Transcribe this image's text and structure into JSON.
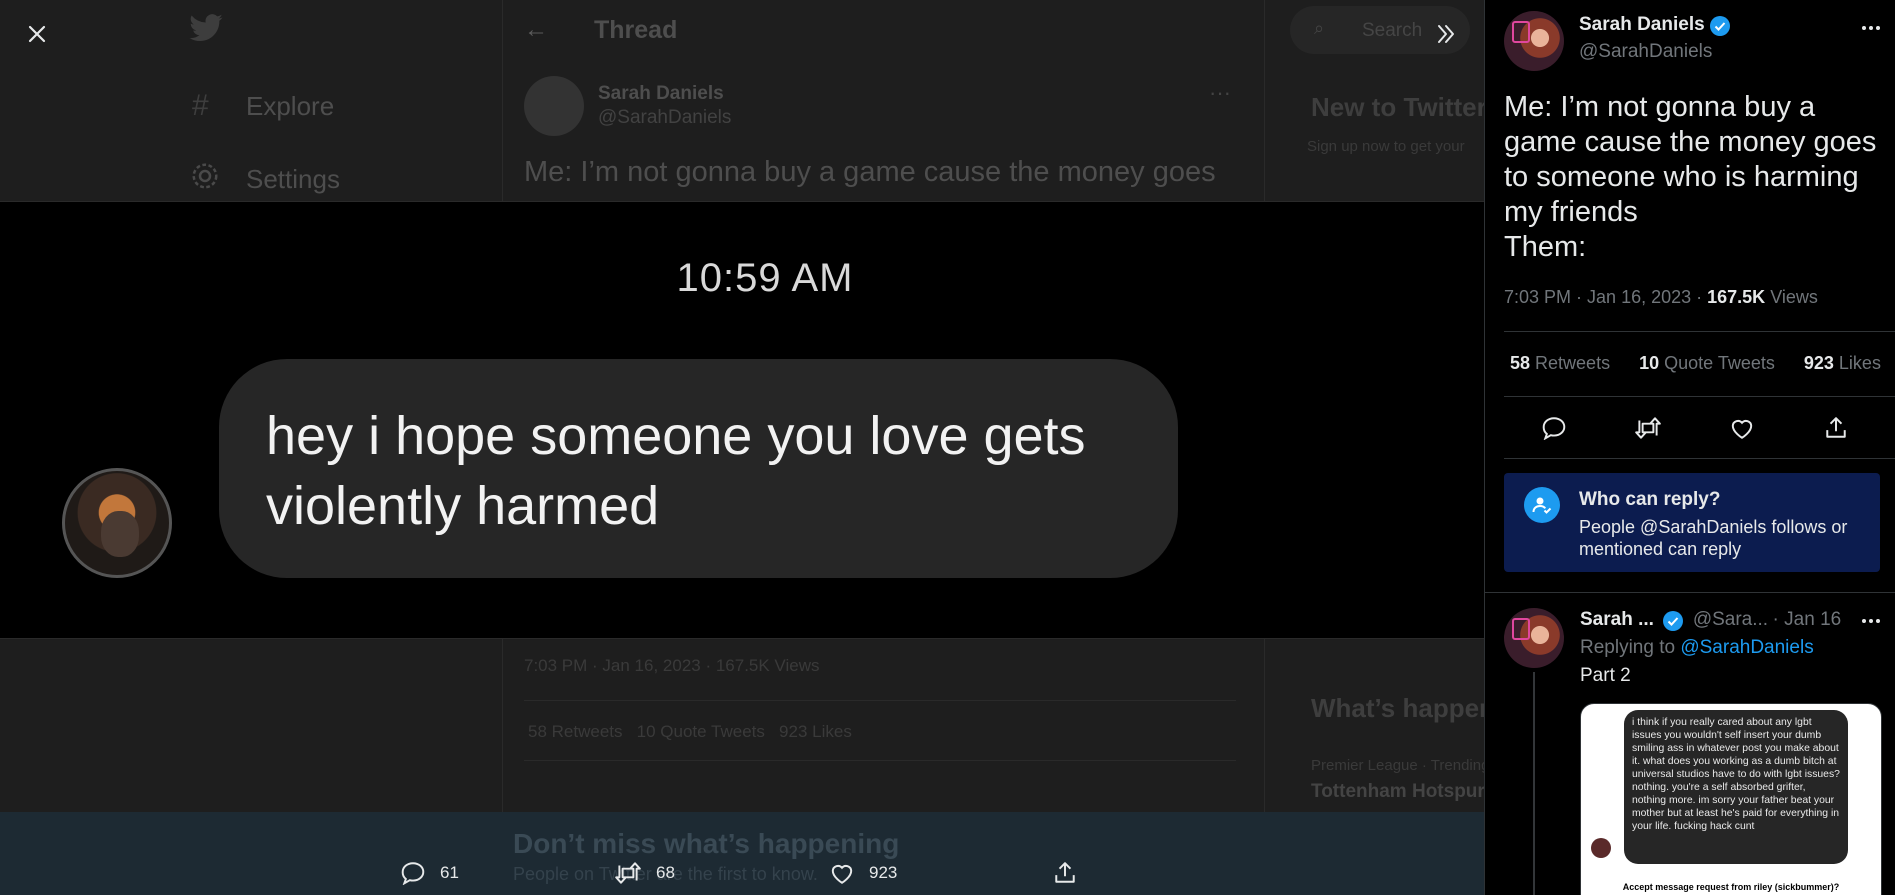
{
  "background": {
    "nav": {
      "explore_label": "Explore",
      "settings_label": "Settings"
    },
    "header": {
      "title": "Thread",
      "search_placeholder": "Search"
    },
    "sidebar": {
      "new_title": "New to Twitter?",
      "new_desc": "Sign up now to get your",
      "happening_title": "What’s happening",
      "trend_meta": "Premier League · Trending",
      "trend_name": "Tottenham Hotspur"
    },
    "tweet": {
      "name": "Sarah Daniels",
      "handle": "@SarahDaniels",
      "text": "Me: I’m not gonna buy a game cause the money goes",
      "meta": "7:03 PM · Jan 16, 2023 · 167.5K Views",
      "stats": "58 Retweets   10 Quote Tweets   923 Likes"
    },
    "banner": {
      "title": "Don’t miss what’s happening",
      "desc": "People on Twitter are the first to know."
    }
  },
  "media": {
    "time": "10:59 AM",
    "message": "hey i hope someone you love gets violently harmed",
    "actions": {
      "replies": "61",
      "retweets": "68",
      "likes": "923"
    }
  },
  "tweet": {
    "author_name": "Sarah Daniels",
    "author_handle": "@SarahDaniels",
    "text_lines": [
      "Me: I’m not gonna buy a",
      "game cause the money goes",
      "to someone who is harming",
      "my friends",
      "Them:"
    ],
    "time": "7:03 PM",
    "date": "Jan 16, 2023",
    "views_count": "167.5K",
    "views_label": "Views",
    "retweets_count": "58",
    "retweets_label": "Retweets",
    "quotes_count": "10",
    "quotes_label": "Quote Tweets",
    "likes_count": "923",
    "likes_label": "Likes"
  },
  "who_can_reply": {
    "title": "Who can reply?",
    "desc": "People @SarahDaniels follows or mentioned can reply"
  },
  "reply": {
    "author_name": "Sarah ...",
    "author_handle": "@Sara...",
    "date": "· Jan 16",
    "replying_prefix": "Replying to",
    "replying_to": "@SarahDaniels",
    "text": "Part 2",
    "image_dm": "i think if you really cared about any lgbt issues you wouldn't self insert your dumb smiling ass in whatever post you make about it. what does you working as a dumb bitch at universal studios have to do with lgbt issues? nothing. you're a self absorbed grifter, nothing more. im sorry your father beat your mother but at least he's paid for everything in your life. fucking hack cunt",
    "image_footer": "Accept message request from riley (sickbummer)?"
  },
  "icons": [
    "close-icon",
    "expand-icon",
    "reply-icon",
    "retweet-icon",
    "like-icon",
    "share-icon",
    "verified-icon",
    "more-icon",
    "person-check-icon",
    "twitter-logo-icon"
  ],
  "colors": {
    "accent": "#1d9bf0",
    "panel_bg": "#000000",
    "who_reply_bg": "#0c1c4f",
    "bubble_bg": "#262626"
  }
}
